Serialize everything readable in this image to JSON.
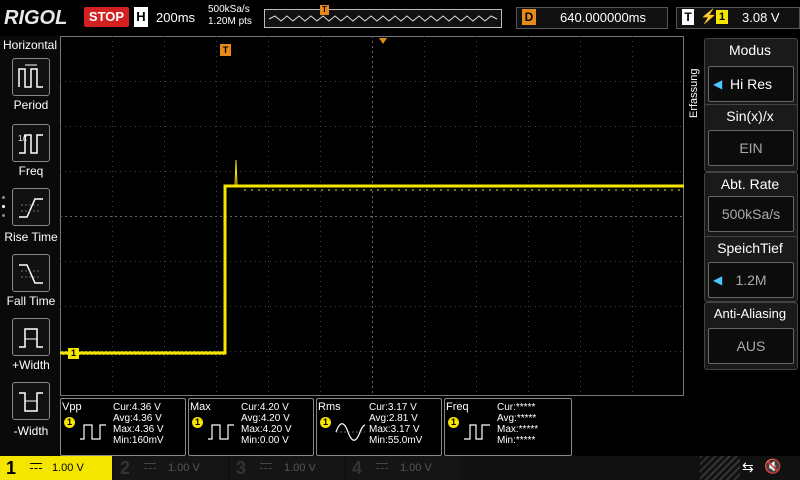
{
  "header": {
    "brand": "RIGOL",
    "run_state": "STOP",
    "timebase_label": "H",
    "timebase": "200ms",
    "sample_rate": "500kSa/s",
    "memory_points": "1.20M pts",
    "delay_label": "D",
    "delay": "640.000000ms",
    "trigger_label": "T",
    "trigger_source": "1",
    "trigger_level": "3.08 V"
  },
  "horizontal_menu": {
    "title": "Horizontal",
    "items": [
      {
        "label": "Period"
      },
      {
        "label": "Freq"
      },
      {
        "label": "Rise Time"
      },
      {
        "label": "Fall Time"
      },
      {
        "label": "+Width"
      },
      {
        "label": "-Width"
      }
    ]
  },
  "acquire_menu": {
    "title": "Erfassung",
    "items": [
      {
        "title": "Modus",
        "value": "Hi Res",
        "has_arrow": true
      },
      {
        "title": "Sin(x)/x",
        "value": "EIN",
        "has_arrow": false
      },
      {
        "title": "Abt. Rate",
        "value": "500kSa/s",
        "has_arrow": false
      },
      {
        "title": "SpeichTief",
        "value": "1.2M",
        "has_arrow": true
      },
      {
        "title": "Anti-Aliasing",
        "value": "AUS",
        "has_arrow": false
      }
    ]
  },
  "measurements": [
    {
      "name": "Vpp",
      "channel": "1",
      "cur": "Cur:4.36 V",
      "avg": "Avg:4.36 V",
      "max": "Max:4.36 V",
      "min": "Min:160mV"
    },
    {
      "name": "Max",
      "channel": "1",
      "cur": "Cur:4.20 V",
      "avg": "Avg:4.20 V",
      "max": "Max:4.20 V",
      "min": "Min:0.00 V"
    },
    {
      "name": "Rms",
      "channel": "1",
      "cur": "Cur:3.17 V",
      "avg": "Avg:2.81 V",
      "max": "Max:3.17 V",
      "min": "Min:55.0mV"
    },
    {
      "name": "Freq",
      "channel": "1",
      "cur": "Cur:*****",
      "avg": "Avg:*****",
      "max": "Max:*****",
      "min": "Min:*****"
    }
  ],
  "channels": [
    {
      "num": "1",
      "scale": "1.00 V",
      "active": true
    },
    {
      "num": "2",
      "scale": "1.00 V",
      "active": false
    },
    {
      "num": "3",
      "scale": "1.00 V",
      "active": false
    },
    {
      "num": "4",
      "scale": "1.00 V",
      "active": false
    }
  ],
  "markers": {
    "channel_marker": "1",
    "trigger_marker": "T"
  },
  "colors": {
    "ch1": "#f5e600",
    "ch2": "#00c8e0",
    "ch3": "#e040c0",
    "ch4": "#2060ff",
    "trigger": "#e88a1a",
    "stop": "#d32020"
  }
}
